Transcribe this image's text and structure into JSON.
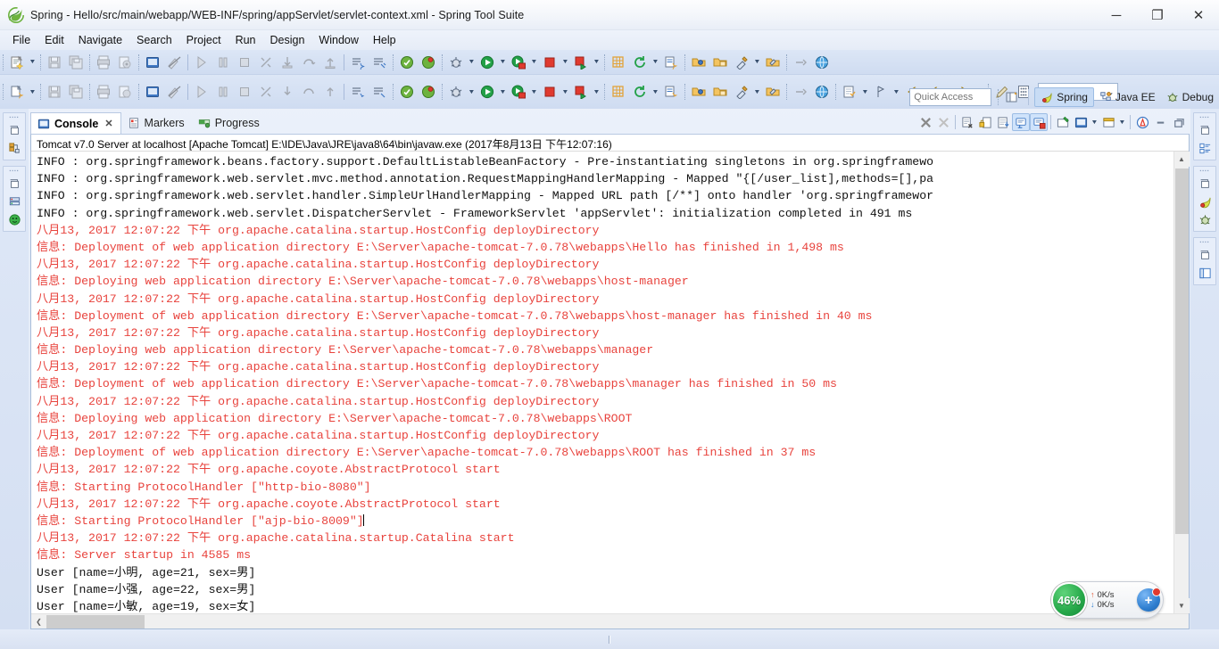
{
  "window": {
    "title": "Spring - Hello/src/main/webapp/WEB-INF/spring/appServlet/servlet-context.xml - Spring Tool Suite",
    "app_icon": "spring-leaf-icon",
    "minimize_glyph": "─",
    "maximize_glyph": "❐",
    "close_glyph": "✕"
  },
  "menubar": {
    "items": [
      {
        "label": "File"
      },
      {
        "label": "Edit"
      },
      {
        "label": "Navigate"
      },
      {
        "label": "Search"
      },
      {
        "label": "Project"
      },
      {
        "label": "Run"
      },
      {
        "label": "Design"
      },
      {
        "label": "Window"
      },
      {
        "label": "Help"
      }
    ]
  },
  "quick_access": {
    "placeholder": "Quick Access"
  },
  "perspectives": [
    {
      "label": "Spring",
      "icon": "spring-perspective-icon",
      "active": true
    },
    {
      "label": "Java EE",
      "icon": "javaee-perspective-icon",
      "active": false
    },
    {
      "label": "Debug",
      "icon": "debug-perspective-icon",
      "active": false
    }
  ],
  "view_tabs": [
    {
      "label": "Console",
      "icon": "console-icon",
      "active": true,
      "closable": true
    },
    {
      "label": "Markers",
      "icon": "markers-icon",
      "active": false,
      "closable": false
    },
    {
      "label": "Progress",
      "icon": "progress-icon",
      "active": false,
      "closable": false
    }
  ],
  "console": {
    "header": "Tomcat v7.0 Server at localhost [Apache Tomcat] E:\\IDE\\Java\\JRE\\java8\\64\\bin\\javaw.exe (2017年8月13日 下午12:07:16)",
    "colors": {
      "log_red": "#e8433d",
      "log_black": "#111111"
    },
    "lines": [
      {
        "color": "black",
        "text": "INFO : org.springframework.beans.factory.support.DefaultListableBeanFactory - Pre-instantiating singletons in org.springframewo"
      },
      {
        "color": "black",
        "text": "INFO : org.springframework.web.servlet.mvc.method.annotation.RequestMappingHandlerMapping - Mapped \"{[/user_list],methods=[],pa"
      },
      {
        "color": "black",
        "text": "INFO : org.springframework.web.servlet.handler.SimpleUrlHandlerMapping - Mapped URL path [/**] onto handler 'org.springframewor"
      },
      {
        "color": "black",
        "text": "INFO : org.springframework.web.servlet.DispatcherServlet - FrameworkServlet 'appServlet': initialization completed in 491 ms"
      },
      {
        "color": "red",
        "text": "八月13, 2017 12:07:22 下午 org.apache.catalina.startup.HostConfig deployDirectory"
      },
      {
        "color": "red",
        "text": "信息: Deployment of web application directory E:\\Server\\apache-tomcat-7.0.78\\webapps\\Hello has finished in 1,498 ms"
      },
      {
        "color": "red",
        "text": "八月13, 2017 12:07:22 下午 org.apache.catalina.startup.HostConfig deployDirectory"
      },
      {
        "color": "red",
        "text": "信息: Deploying web application directory E:\\Server\\apache-tomcat-7.0.78\\webapps\\host-manager"
      },
      {
        "color": "red",
        "text": "八月13, 2017 12:07:22 下午 org.apache.catalina.startup.HostConfig deployDirectory"
      },
      {
        "color": "red",
        "text": "信息: Deployment of web application directory E:\\Server\\apache-tomcat-7.0.78\\webapps\\host-manager has finished in 40 ms"
      },
      {
        "color": "red",
        "text": "八月13, 2017 12:07:22 下午 org.apache.catalina.startup.HostConfig deployDirectory"
      },
      {
        "color": "red",
        "text": "信息: Deploying web application directory E:\\Server\\apache-tomcat-7.0.78\\webapps\\manager"
      },
      {
        "color": "red",
        "text": "八月13, 2017 12:07:22 下午 org.apache.catalina.startup.HostConfig deployDirectory"
      },
      {
        "color": "red",
        "text": "信息: Deployment of web application directory E:\\Server\\apache-tomcat-7.0.78\\webapps\\manager has finished in 50 ms"
      },
      {
        "color": "red",
        "text": "八月13, 2017 12:07:22 下午 org.apache.catalina.startup.HostConfig deployDirectory"
      },
      {
        "color": "red",
        "text": "信息: Deploying web application directory E:\\Server\\apache-tomcat-7.0.78\\webapps\\ROOT"
      },
      {
        "color": "red",
        "text": "八月13, 2017 12:07:22 下午 org.apache.catalina.startup.HostConfig deployDirectory"
      },
      {
        "color": "red",
        "text": "信息: Deployment of web application directory E:\\Server\\apache-tomcat-7.0.78\\webapps\\ROOT has finished in 37 ms"
      },
      {
        "color": "red",
        "text": "八月13, 2017 12:07:22 下午 org.apache.coyote.AbstractProtocol start"
      },
      {
        "color": "red",
        "text": "信息: Starting ProtocolHandler [\"http-bio-8080\"]"
      },
      {
        "color": "red",
        "text": "八月13, 2017 12:07:22 下午 org.apache.coyote.AbstractProtocol start"
      },
      {
        "color": "red",
        "text": "信息: Starting ProtocolHandler [\"ajp-bio-8009\"]",
        "caret": true
      },
      {
        "color": "red",
        "text": "八月13, 2017 12:07:22 下午 org.apache.catalina.startup.Catalina start"
      },
      {
        "color": "red",
        "text": "信息: Server startup in 4585 ms"
      },
      {
        "color": "black",
        "text": "User [name=小明, age=21, sex=男]"
      },
      {
        "color": "black",
        "text": "User [name=小强, age=22, sex=男]"
      },
      {
        "color": "black",
        "text": "User [name=小敏, age=19, sex=女]"
      }
    ]
  },
  "console_toolbar": [
    {
      "name": "terminate-icon"
    },
    {
      "name": "remove-launch-icon"
    },
    {
      "name": "remove-all-terminated-icon"
    },
    {
      "name": "clear-console-icon"
    },
    {
      "name": "scroll-lock-icon"
    },
    {
      "name": "pin-console-icon"
    },
    {
      "name": "display-selected-console-icon"
    },
    {
      "name": "open-console-icon"
    },
    {
      "name": "new-console-view-icon"
    },
    {
      "name": "word-wrap-icon"
    },
    {
      "name": "minimize-icon"
    },
    {
      "name": "maximize-icon"
    }
  ],
  "netmon": {
    "cpu_percent": "46%",
    "upload_rate": "0K/s",
    "download_rate": "0K/s",
    "up_arrow": "↑",
    "down_arrow": "↓",
    "plus_label": "+"
  },
  "scrollbars": {
    "v_up": "▲",
    "v_down": "▼",
    "h_left": "❮",
    "h_right": "❯"
  }
}
